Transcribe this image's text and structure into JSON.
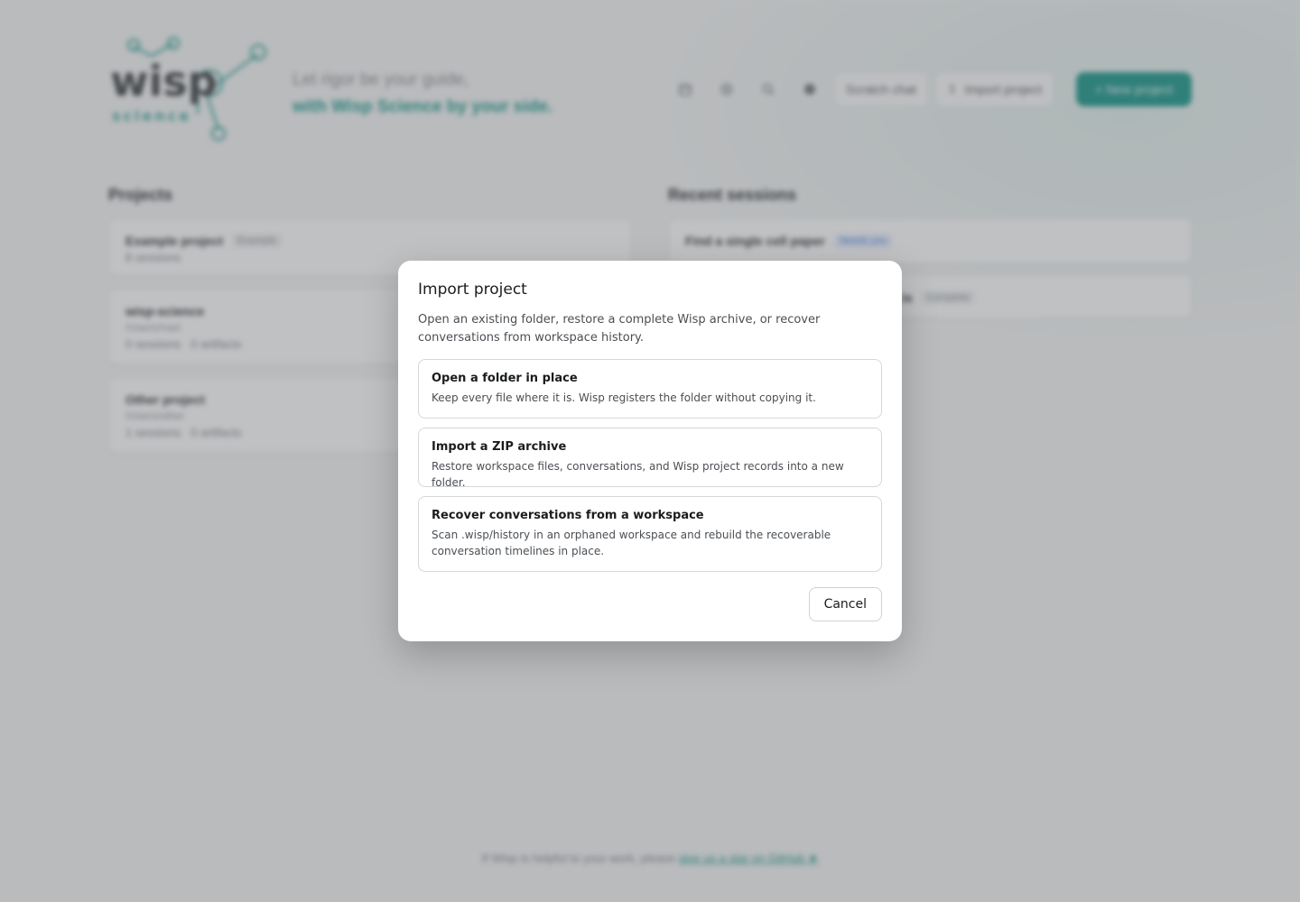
{
  "header": {
    "logo_word": "wisp",
    "logo_sub": "science",
    "tagline_line1": "Let rigor be your guide,",
    "tagline_line2": "with Wisp Science by your side.",
    "scratch_chat": "Scratch chat",
    "import_project": "Import project",
    "new_project": "+ New project",
    "icons": [
      "calendar-icon",
      "settings-icon",
      "search-icon",
      "globe-icon"
    ]
  },
  "projects": {
    "title": "Projects",
    "items": [
      {
        "name": "Example project",
        "tag": "Example",
        "sessions": "8 sessions"
      },
      {
        "name": "wisp-science",
        "path": "/Users/mari",
        "sessions": "0 sessions",
        "artifacts": "0 artifacts"
      },
      {
        "name": "Other project",
        "path": "/Users/other",
        "sessions": "1 sessions",
        "artifacts": "0 artifacts"
      }
    ]
  },
  "recent": {
    "title": "Recent sessions",
    "items": [
      {
        "name": "Find a single cell paper",
        "tag": "Needs you"
      },
      {
        "name": "…is",
        "tag": "Complete"
      }
    ]
  },
  "footer": {
    "text": "If Wisp is helpful to your work, please",
    "link": "give us a star on GitHub ★"
  },
  "modal": {
    "title": "Import project",
    "description": "Open an existing folder, restore a complete Wisp archive, or recover conversations from workspace history.",
    "options": [
      {
        "title": "Open a folder in place",
        "description": "Keep every file where it is. Wisp registers the folder without copying it."
      },
      {
        "title": "Import a ZIP archive",
        "description": "Restore workspace files, conversations, and Wisp project records into a new folder."
      },
      {
        "title": "Recover conversations from a workspace",
        "description": "Scan .wisp/history in an orphaned workspace and rebuild the recoverable conversation timelines in place."
      }
    ],
    "cancel": "Cancel"
  },
  "colors": {
    "accent": "#17978a",
    "overlay": "rgba(90,92,96,0.38)"
  }
}
